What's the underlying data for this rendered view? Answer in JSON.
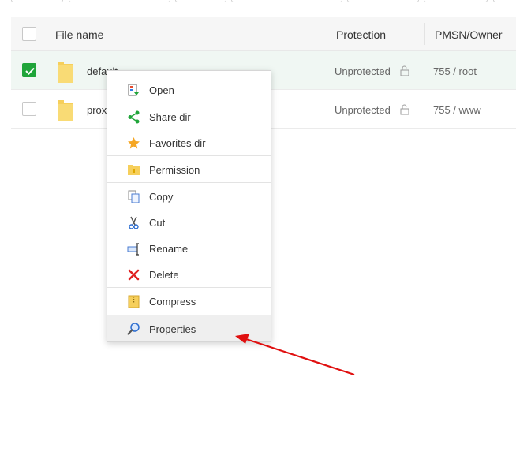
{
  "table": {
    "headers": {
      "file_name": "File name",
      "protection": "Protection",
      "owner": "PMSN/Owner"
    },
    "rows": [
      {
        "name": "default",
        "protection": "Unprotected",
        "owner": "755 / root",
        "checked": true
      },
      {
        "name": "prox",
        "protection": "Unprotected",
        "owner": "755 / www",
        "checked": false
      }
    ]
  },
  "context_menu": {
    "items": [
      {
        "label": "Open",
        "icon": "open-icon"
      },
      {
        "label": "Share dir",
        "icon": "share-icon"
      },
      {
        "label": "Favorites dir",
        "icon": "star-icon"
      },
      {
        "label": "Permission",
        "icon": "permission-folder-icon"
      },
      {
        "label": "Copy",
        "icon": "copy-icon"
      },
      {
        "label": "Cut",
        "icon": "scissors-icon"
      },
      {
        "label": "Rename",
        "icon": "rename-icon"
      },
      {
        "label": "Delete",
        "icon": "delete-x-icon"
      },
      {
        "label": "Compress",
        "icon": "zip-icon"
      },
      {
        "label": "Properties",
        "icon": "properties-magnifier-icon",
        "highlighted": true
      }
    ]
  },
  "colors": {
    "accent_green": "#20a53a",
    "annotation_arrow": "#e01010",
    "folder_yellow": "#f6cf5b"
  }
}
